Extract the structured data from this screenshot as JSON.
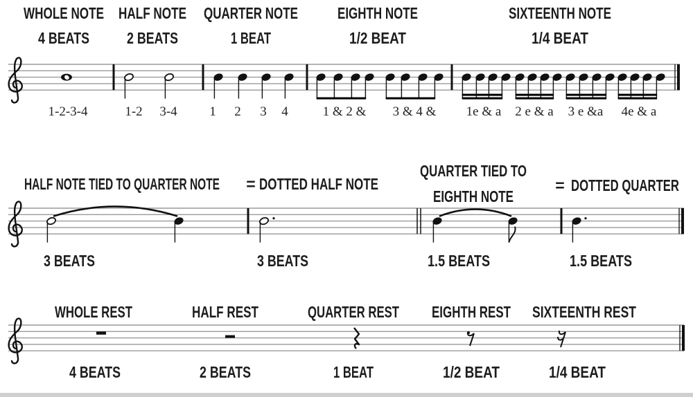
{
  "row1": {
    "headings": [
      {
        "name": "WHOLE NOTE",
        "beats": "4 BEATS"
      },
      {
        "name": "HALF NOTE",
        "beats": "2 BEATS"
      },
      {
        "name": "QUARTER NOTE",
        "beats": "1 BEAT"
      },
      {
        "name": "EIGHTH NOTE",
        "beats": "1/2 BEAT"
      },
      {
        "name": "SIXTEENTH NOTE",
        "beats": "1/4 BEAT"
      }
    ],
    "counts": [
      "1-2-3-4",
      "1-2",
      "3-4",
      "1",
      "2",
      "3",
      "4",
      "1 & 2 &",
      "3 & 4 &",
      "1e & a",
      "2 e & a",
      "3 e &a",
      "4e & a"
    ]
  },
  "row2": {
    "heading_left": "HALF NOTE TIED TO QUARTER NOTE",
    "equals_left": "=",
    "result_left": "DOTTED HALF NOTE",
    "heading_right_line1": "QUARTER TIED TO",
    "heading_right_line2": "EIGHTH NOTE",
    "equals_right": "=",
    "result_right": "DOTTED QUARTER",
    "beats": [
      "3 BEATS",
      "3 BEATS",
      "1.5 BEATS",
      "1.5 BEATS"
    ]
  },
  "row3": {
    "rests": [
      {
        "name": "WHOLE REST",
        "beats": "4 BEATS"
      },
      {
        "name": "HALF REST",
        "beats": "2 BEATS"
      },
      {
        "name": "QUARTER REST",
        "beats": "1 BEAT"
      },
      {
        "name": "EIGHTH REST",
        "beats": "1/2 BEAT"
      },
      {
        "name": "SIXTEENTH REST",
        "beats": "1/4 BEAT"
      }
    ]
  },
  "colors": {
    "ink": "#111111",
    "staff_lines": "#9a9a9a",
    "bottom_bar": "#cfcfcf"
  }
}
